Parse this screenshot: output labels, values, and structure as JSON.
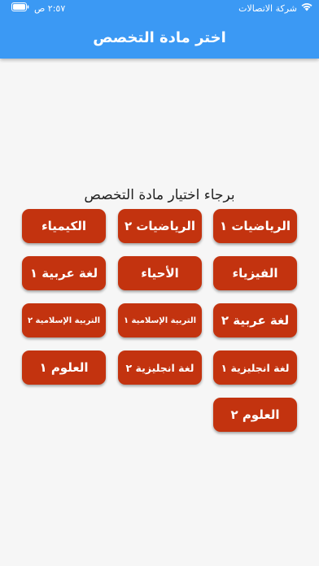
{
  "status_bar": {
    "carrier": "شركة الاتصالات",
    "time": "٢:٥٧ ص"
  },
  "header": {
    "title": "اختر مادة التخصص"
  },
  "subtitle": "برجاء اختيار مادة التخصص",
  "subjects": [
    {
      "label": "الرياضيات ١"
    },
    {
      "label": "الرياضيات ٢"
    },
    {
      "label": "الكيمياء"
    },
    {
      "label": "الفيزياء"
    },
    {
      "label": "الأحياء"
    },
    {
      "label": "لغة عربية ١"
    },
    {
      "label": "لغة عربية ٢"
    },
    {
      "label": "التربية الإسلامية ١"
    },
    {
      "label": "التربية الإسلامية ٢"
    },
    {
      "label": "لغة انجليزية ١"
    },
    {
      "label": "لغة انجليزية ٢"
    },
    {
      "label": "العلوم ١"
    },
    {
      "label": "العلوم ٢"
    }
  ],
  "colors": {
    "header": "#3b99f4",
    "button": "#c3330f",
    "background": "#f6f6f6"
  }
}
